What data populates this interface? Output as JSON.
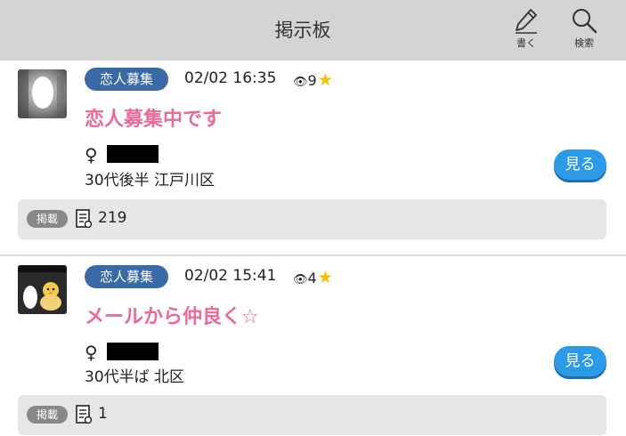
{
  "header": {
    "title": "掲示板",
    "write_label": "書く",
    "search_label": "検索",
    "write_icon": "pencil-icon",
    "search_icon": "magnifier-icon"
  },
  "posts": [
    {
      "category": "恋人募集",
      "datetime": "02/02 16:35",
      "views": "9",
      "title": "恋人募集中です",
      "gender_symbol": "♀",
      "profile": "30代後半 江戸川区",
      "view_button": "見る",
      "posted_badge": "掲載",
      "posted_count": "219"
    },
    {
      "category": "恋人募集",
      "datetime": "02/02 15:41",
      "views": "4",
      "title": "メールから仲良く☆",
      "gender_symbol": "♀",
      "profile": "30代半ば 北区",
      "view_button": "見る",
      "posted_badge": "掲載",
      "posted_count": "1"
    }
  ],
  "colors": {
    "header_bg": "#d4d4d4",
    "category_badge": "#3a6aa6",
    "title_pink": "#ec6a9b",
    "button_blue": "#2b9be8",
    "star": "#f5c000"
  }
}
